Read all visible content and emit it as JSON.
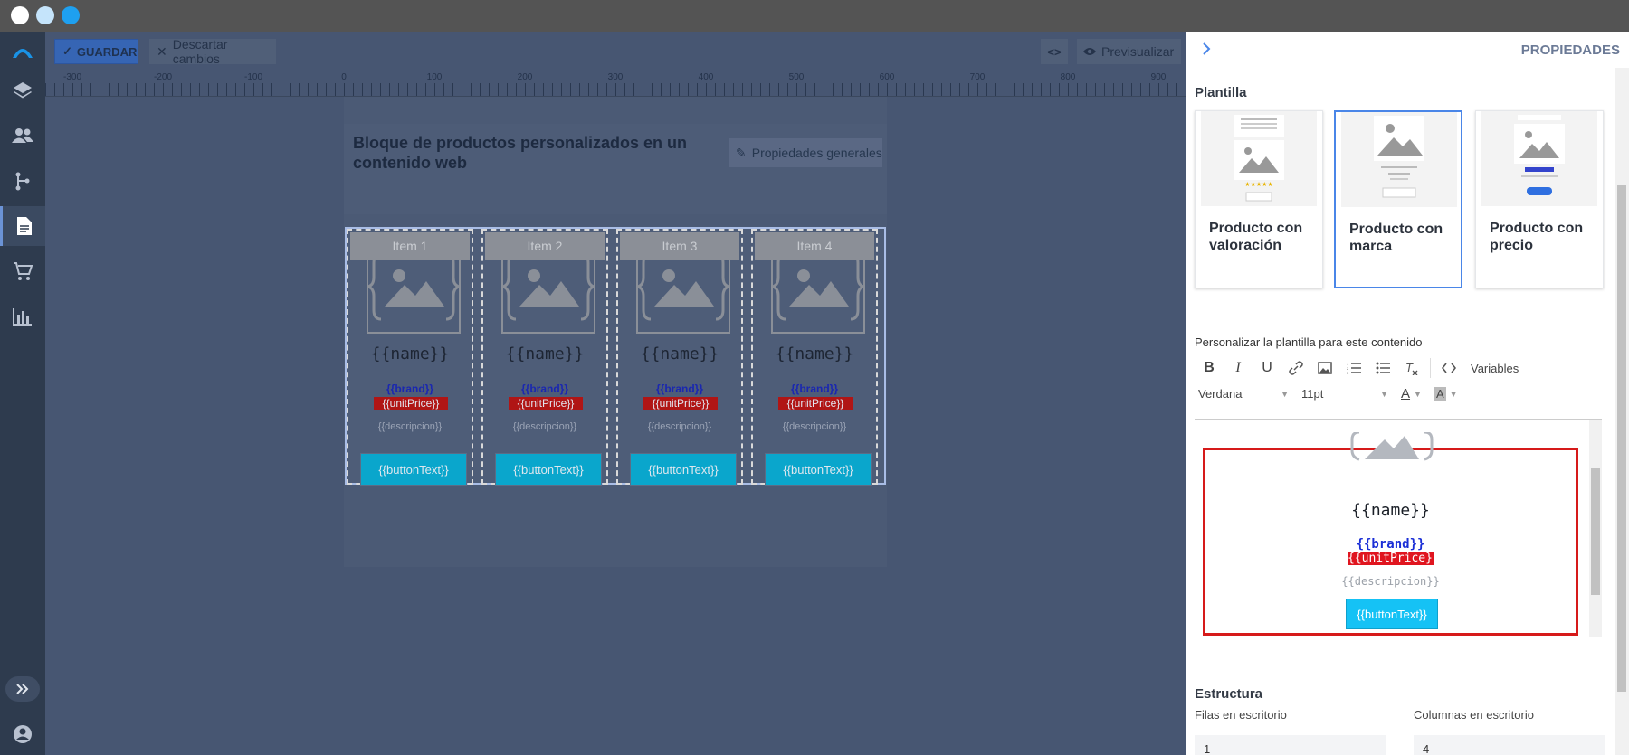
{
  "toolbar": {
    "save_label": "GUARDAR",
    "discard_label": "Descartar cambios",
    "preview_label": "Previsualizar"
  },
  "ruler": {
    "labels": [
      "-300",
      "-200",
      "-100",
      "0",
      "100",
      "200",
      "300",
      "400",
      "500",
      "600",
      "700",
      "800",
      "900"
    ]
  },
  "canvas": {
    "title": "Bloque de productos personalizados en un contenido web",
    "general_props_label": "Propiedades generales",
    "items": [
      {
        "header": "Item 1",
        "name": "{{name}}",
        "brand": "{{brand}}",
        "price": "{{unitPrice}}",
        "desc": "{{descripcion}}",
        "button": "{{buttonText}}"
      },
      {
        "header": "Item 2",
        "name": "{{name}}",
        "brand": "{{brand}}",
        "price": "{{unitPrice}}",
        "desc": "{{descripcion}}",
        "button": "{{buttonText}}"
      },
      {
        "header": "Item 3",
        "name": "{{name}}",
        "brand": "{{brand}}",
        "price": "{{unitPrice}}",
        "desc": "{{descripcion}}",
        "button": "{{buttonText}}"
      },
      {
        "header": "Item 4",
        "name": "{{name}}",
        "brand": "{{brand}}",
        "price": "{{unitPrice}}",
        "desc": "{{descripcion}}",
        "button": "{{buttonText}}"
      }
    ]
  },
  "panel": {
    "title": "PROPIEDADES",
    "template_section": "Plantilla",
    "templates": [
      {
        "label": "Producto con valoración",
        "selected": false
      },
      {
        "label": "Producto con marca",
        "selected": true
      },
      {
        "label": "Producto con precio",
        "selected": false
      }
    ],
    "customize_label": "Personalizar la plantilla para este contenido",
    "variables_label": "Variables",
    "font_family": "Verdana",
    "font_size": "11pt",
    "preview": {
      "name": "{{name}}",
      "brand": "{{brand}}",
      "price": "{{unitPrice}}",
      "desc": "{{descripcion}}",
      "button": "{{buttonText}}"
    },
    "structure_section": "Estructura",
    "rows_label": "Filas en escritorio",
    "rows_value": "1",
    "cols_label": "Columnas en escritorio",
    "cols_value": "4"
  },
  "colors": {
    "accent": "#4a86e8",
    "button": "#0aa6cc",
    "price_bg": "#b01515",
    "brand": "#1a27b0",
    "selection": "#d61a1a"
  }
}
